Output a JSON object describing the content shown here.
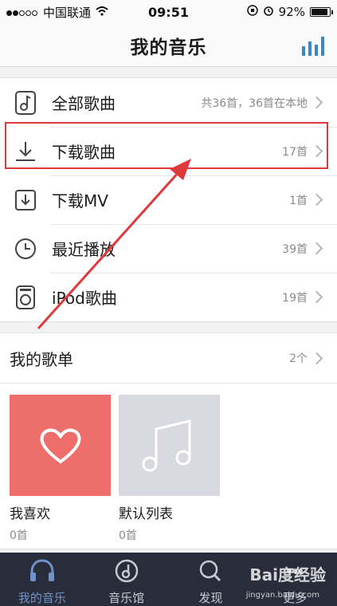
{
  "status_bar": {
    "carrier": "中国联通",
    "time": "09:51",
    "battery": "92%"
  },
  "nav": {
    "title": "我的音乐",
    "equalizer_icon": "equalizer-icon"
  },
  "list": [
    {
      "icon": "music-note-icon",
      "label": "全部歌曲",
      "meta": "共36首，36首在本地"
    },
    {
      "icon": "download-icon",
      "label": "下载歌曲",
      "meta": "17首"
    },
    {
      "icon": "download-mv-icon",
      "label": "下载MV",
      "meta": "1首"
    },
    {
      "icon": "clock-icon",
      "label": "最近播放",
      "meta": "39首"
    },
    {
      "icon": "ipod-icon",
      "label": "iPod歌曲",
      "meta": "19首"
    }
  ],
  "playlists": {
    "title": "我的歌单",
    "count": "2个",
    "cards": [
      {
        "name": "我喜欢",
        "count": "0首",
        "cover": "heart-icon"
      },
      {
        "name": "默认列表",
        "count": "0首",
        "cover": "music-note-icon"
      }
    ]
  },
  "tabs": [
    {
      "label": "我的音乐",
      "icon": "headphones-icon",
      "active": true
    },
    {
      "label": "音乐馆",
      "icon": "music-hall-icon",
      "active": false
    },
    {
      "label": "发现",
      "icon": "search-icon",
      "active": false
    },
    {
      "label": "更多",
      "icon": "more-icon",
      "active": false
    }
  ],
  "watermark": {
    "text": "Bai度经验",
    "url": "jingyan.baidu.com"
  },
  "colors": {
    "accent": "#3b86c6",
    "highlight": "#e0393b",
    "tabbar": "#282c3b",
    "fav_cover": "#ee6e6c",
    "default_cover": "#d8d9e1"
  }
}
